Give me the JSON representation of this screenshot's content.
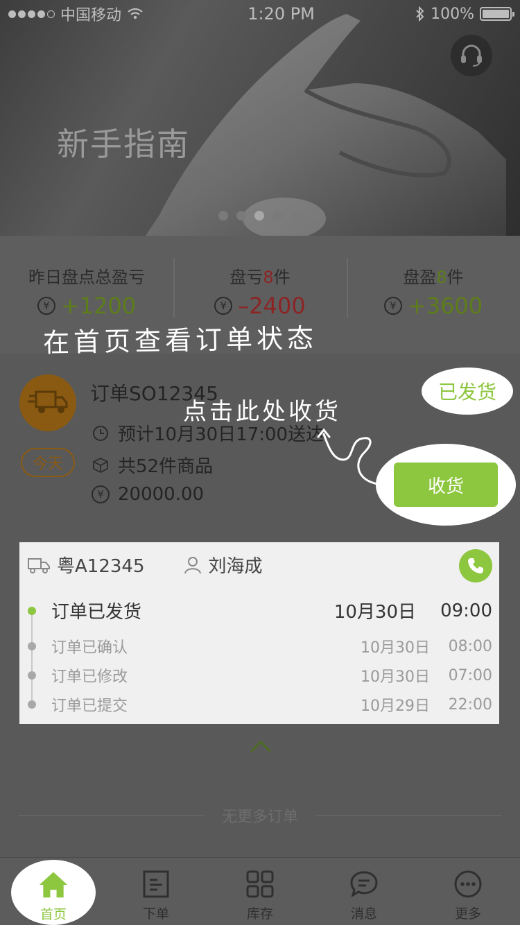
{
  "status_bar": {
    "carrier": "中国移动",
    "time": "1:20 PM",
    "battery": "100%",
    "battery_level": 1.0
  },
  "banner": {
    "title": "新手指南",
    "page_count": 5,
    "active_page": 3
  },
  "stats": [
    {
      "label": "昨日盘点总盈亏",
      "value": "+1200",
      "color": "#5d7d1a"
    },
    {
      "label_prefix": "盘亏",
      "count": "8",
      "label_suffix": "件",
      "value": "–2400",
      "color": "#8c2424"
    },
    {
      "label_prefix": "盘盈",
      "count": "8",
      "label_suffix": "件",
      "value": "+3600",
      "color": "#5d7d1a"
    }
  ],
  "hints": {
    "view_status": "在首页查看订单状态",
    "click_receive": "点击此处收货"
  },
  "order": {
    "number": "订单SO12345",
    "eta": "预计10月30日17:00送达",
    "items": "共52件商品",
    "amount": "20000.00",
    "day_badge": "今天",
    "status_badge": "已发货",
    "receive_button": "收货"
  },
  "tracking": {
    "plate": "粤A12345",
    "driver": "刘海成",
    "events": [
      {
        "status": "订单已发货",
        "date": "10月30日",
        "time": "09:00"
      },
      {
        "status": "订单已确认",
        "date": "10月30日",
        "time": "08:00"
      },
      {
        "status": "订单已修改",
        "date": "10月30日",
        "time": "07:00"
      },
      {
        "status": "订单已提交",
        "date": "10月29日",
        "time": "22:00"
      }
    ]
  },
  "no_more": "无更多订单",
  "tabs": [
    {
      "label": "首页",
      "icon": "home-icon"
    },
    {
      "label": "下单",
      "icon": "order-form-icon"
    },
    {
      "label": "库存",
      "icon": "inventory-grid-icon"
    },
    {
      "label": "消息",
      "icon": "message-icon"
    },
    {
      "label": "更多",
      "icon": "more-icon"
    }
  ],
  "colors": {
    "accent": "#8dc63f",
    "loss": "#8c2424",
    "badge": "#8a5a12"
  }
}
